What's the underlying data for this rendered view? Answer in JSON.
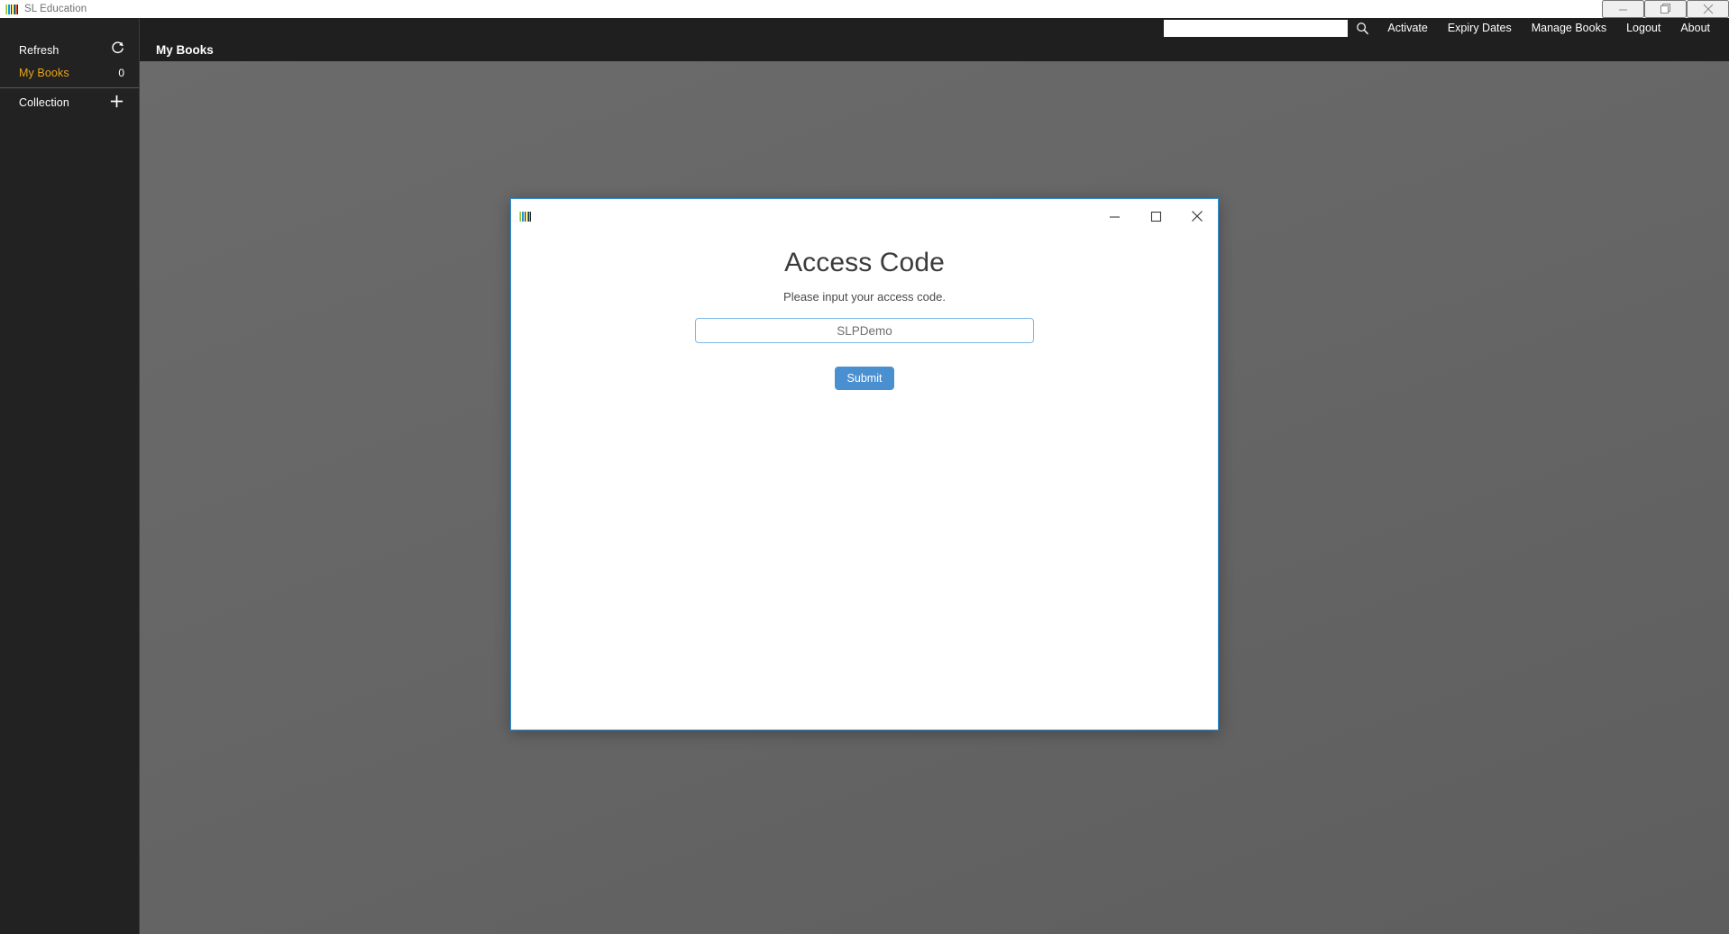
{
  "os_window": {
    "title": "SL Education",
    "icon": "barcode-logo-icon",
    "controls": {
      "minimize_label": "Minimize",
      "restore_label": "Restore",
      "close_label": "Close"
    }
  },
  "navbar": {
    "search": {
      "value": "",
      "placeholder": "",
      "icon": "search-icon"
    },
    "links": [
      {
        "label": "Activate"
      },
      {
        "label": "Expiry Dates"
      },
      {
        "label": "Manage Books"
      },
      {
        "label": "Logout"
      },
      {
        "label": "About"
      }
    ]
  },
  "sidebar": {
    "items": [
      {
        "label": "Refresh",
        "value": "",
        "icon": "refresh-icon",
        "glyph": "↻",
        "accent": false
      },
      {
        "label": "My Books",
        "value": "0",
        "icon": "",
        "glyph": "",
        "accent": true
      },
      {
        "label": "Collection",
        "value": "",
        "icon": "plus-icon",
        "glyph": "＋",
        "accent": false
      }
    ]
  },
  "content": {
    "page_title": "My Books"
  },
  "dialog": {
    "icon": "barcode-logo-icon",
    "heading": "Access Code",
    "subtitle": "Please input your access code.",
    "input": {
      "value": "",
      "placeholder": "SLPDemo"
    },
    "submit_label": "Submit",
    "controls": {
      "minimize_label": "Minimize",
      "maximize_label": "Maximize",
      "close_label": "Close"
    }
  },
  "colors": {
    "sidebar_bg": "#222222",
    "navbar_bg": "#1f1f1f",
    "canvas_bg": "#666666",
    "accent_yellow": "#e8a318",
    "dialog_border_blue": "#2d8fd5",
    "submit_blue": "#4a90d0",
    "input_border_blue": "#7cb9e8",
    "logo_stripes": [
      "#ffd400",
      "#8cc63f",
      "#00a8e8",
      "#e8453c",
      "#ffffff",
      "#2b2b2b",
      "#ffd400",
      "#00a8e8"
    ]
  }
}
